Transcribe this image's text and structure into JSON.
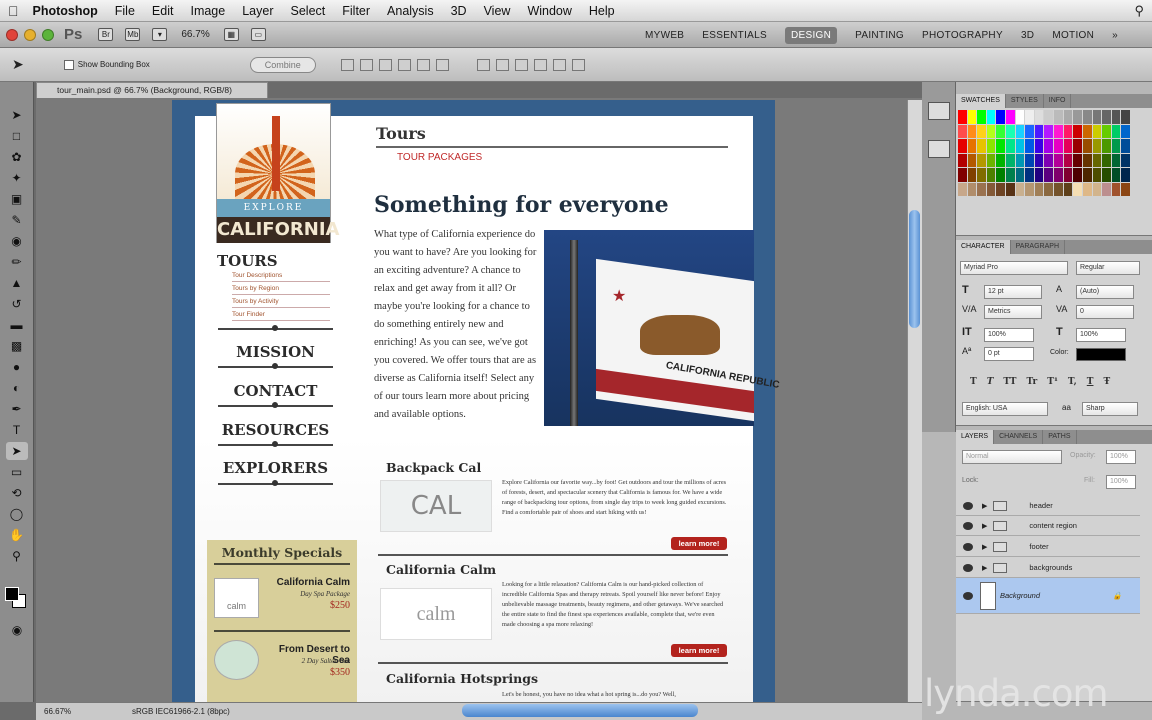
{
  "menubar": {
    "app": "Photoshop",
    "items": [
      "File",
      "Edit",
      "Image",
      "Layer",
      "Select",
      "Filter",
      "Analysis",
      "3D",
      "View",
      "Window",
      "Help"
    ]
  },
  "appbar": {
    "ps_logo": "Ps",
    "zoom": "66.7%",
    "workspaces": [
      "MYWEB",
      "ESSENTIALS",
      "DESIGN",
      "PAINTING",
      "PHOTOGRAPHY",
      "3D",
      "MOTION"
    ],
    "active_workspace": "DESIGN"
  },
  "options": {
    "show_bounding_box": "Show Bounding Box",
    "combine": "Combine"
  },
  "document": {
    "tab": "tour_main.psd @ 66.7% (Background, RGB/8)",
    "status_zoom": "66.67%",
    "status_profile": "sRGB IEC61966-2.1 (8bpc)"
  },
  "site": {
    "logo_explore": "EXPLORE",
    "logo_california": "CALIFORNIA",
    "nav_tours": "TOURS",
    "nav_sublinks": [
      "Tour Descriptions",
      "Tours by Region",
      "Tours by Activity",
      "Tour Finder"
    ],
    "nav": [
      "MISSION",
      "CONTACT",
      "RESOURCES",
      "EXPLORERS"
    ],
    "specials_title": "Monthly Specials",
    "specials": [
      {
        "title": "California Calm",
        "sub": "Day Spa Package",
        "price": "$250",
        "img": "calm"
      },
      {
        "title": "From Desert to Sea",
        "sub": "2 Day Salton Sea",
        "price": "$350",
        "img": ""
      }
    ],
    "heading_tours": "Tours",
    "tour_packages": "TOUR PACKAGES",
    "headline": "Something for everyone",
    "intro": "What type of California experience do you want to have? Are you looking for an exciting adventure? A chance to relax and get away from it all? Or maybe you're looking for a chance to do something entirely new and enriching! As you can see, we've got you covered. We offer tours that are as diverse as California itself! Select any of our tours learn more about pricing and available options.",
    "flag_text": "CALIFORNIA REPUBLIC",
    "sections": [
      {
        "title": "Backpack Cal",
        "img": "CAL",
        "text": "Explore California our favorite way...by foot! Get outdoors and tour the millions of acres of forests, desert, and spectacular scenery that California is famous for. We have a wide range of backpacking tour options, from single day trips to week long guided excursions. Find a comfortable pair of shoes and start hiking with us!",
        "button": "learn more!"
      },
      {
        "title": "California Calm",
        "img": "calm",
        "text": "Looking for a little relaxation? California Calm is our hand-picked collection of incredible California Spas and therapy retreats. Spoil yourself like never before! Enjoy unbelievable massage treatments, beauty regimens, and other getaways. We've searched the entire state to find the finest spa experiences available, complete that, we're even made choosing a spa more relaxing!",
        "button": "learn more!"
      },
      {
        "title": "California Hotsprings",
        "img": "",
        "text": "Let's be honest, you have no idea what a hot spring is...do you? Well,",
        "button": ""
      }
    ]
  },
  "panels": {
    "tabs1": [
      "SWATCHES",
      "STYLES",
      "INFO"
    ],
    "tabs2": [
      "CHARACTER",
      "PARAGRAPH"
    ],
    "tabs3": [
      "LAYERS",
      "CHANNELS",
      "PATHS"
    ],
    "character": {
      "font": "Myriad Pro",
      "style": "Regular",
      "size": "12 pt",
      "leading": "(Auto)",
      "kerning": "Metrics",
      "tracking": "0",
      "vscale": "100%",
      "hscale": "100%",
      "baseline": "0 pt",
      "color_label": "Color:",
      "language": "English: USA",
      "aa_label": "aa",
      "antialias": "Sharp",
      "formatting": [
        "T",
        "T",
        "TT",
        "Tr",
        "T¹",
        "T,",
        "T",
        "Ŧ"
      ]
    },
    "layers": {
      "blend": "Normal",
      "opacity_label": "Opacity:",
      "opacity": "100%",
      "lock_label": "Lock:",
      "fill_label": "Fill:",
      "fill": "100%",
      "items": [
        "header",
        "content region",
        "footer",
        "backgrounds",
        "Background"
      ],
      "selected": "Background"
    }
  },
  "watermark": "lynda.com",
  "colors": {
    "accent": "#355f8c",
    "red": "#b3231d",
    "selection": "#acc8ef"
  }
}
